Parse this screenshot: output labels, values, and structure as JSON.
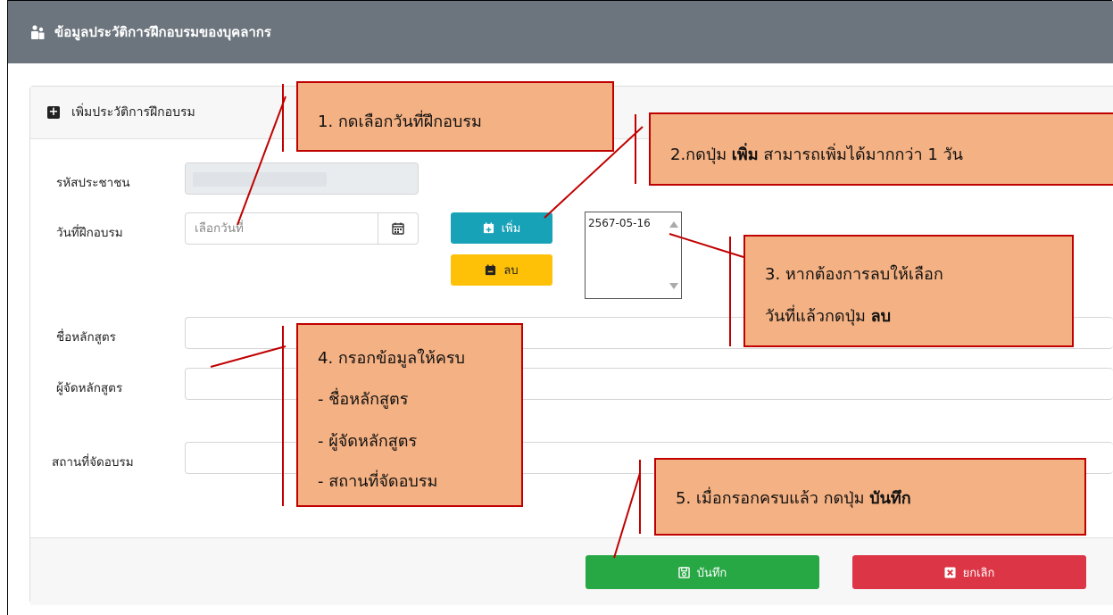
{
  "header": {
    "title": "ข้อมูลประวัติการฝึกอบรมของบุคลากร",
    "icon": "users-icon"
  },
  "card": {
    "header_title": "เพิ่มประวัติการฝึกอบรม",
    "header_icon": "plus-square-icon"
  },
  "form": {
    "citizen_id_label": "รหัสประชาชน",
    "citizen_id_value": "",
    "training_date_label": "วันที่ฝึกอบรม",
    "training_date_placeholder": "เลือกวันที่",
    "course_name_label": "ชื่อหลักสูตร",
    "course_organizer_label": "ผู้จัดหลักสูตร",
    "training_place_label": "สถานที่จัดอบรม"
  },
  "buttons": {
    "add": "เพิ่ม",
    "delete": "ลบ",
    "save": "บันทึก",
    "cancel": "ยกเลิก"
  },
  "selected_dates": [
    "2567-05-16"
  ],
  "callouts": {
    "c1": "1. กดเลือกวันที่ฝึกอบรม",
    "c2_pre": "2.กดปุ่ม ",
    "c2_bold": "เพิ่ม",
    "c2_post": " สามารถเพิ่มได้มากกว่า 1 วัน",
    "c3_line1": "3. หากต้องการลบให้เลือก",
    "c3_pre": "วันที่แล้วกดปุ่ม ",
    "c3_bold": "ลบ",
    "c4_line1": "4. กรอกข้อมูลให้ครบ",
    "c4_line2": "- ชื่อหลักสูตร",
    "c4_line3": "- ผู้จัดหลักสูตร",
    "c4_line4": "- สถานที่จัดอบรม",
    "c5_pre": "5. เมื่อกรอกครบแล้ว กดปุ่ม ",
    "c5_bold": "บันทึก"
  },
  "colors": {
    "titlebar": "#6c757d",
    "add": "#17a2b8",
    "delete": "#ffc107",
    "save": "#28a745",
    "cancel": "#dc3545",
    "callout_fill": "#f4b183",
    "callout_border": "#c00000"
  }
}
